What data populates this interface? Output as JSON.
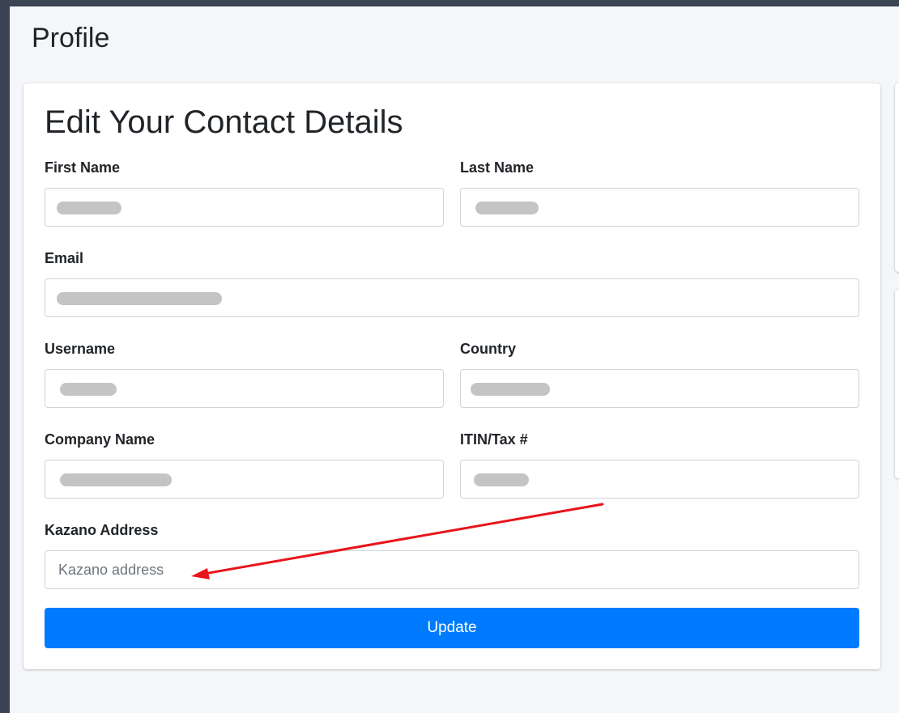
{
  "page": {
    "title": "Profile"
  },
  "form": {
    "heading": "Edit Your Contact Details",
    "fields": {
      "first_name": {
        "label": "First Name",
        "value": ""
      },
      "last_name": {
        "label": "Last Name",
        "value": ""
      },
      "email": {
        "label": "Email",
        "value": ""
      },
      "username": {
        "label": "Username",
        "value": ""
      },
      "country": {
        "label": "Country",
        "value": ""
      },
      "company_name": {
        "label": "Company Name",
        "value": ""
      },
      "tax": {
        "label": "ITIN/Tax #",
        "value": ""
      },
      "kazano_address": {
        "label": "Kazano Address",
        "value": "",
        "placeholder": "Kazano address"
      }
    },
    "submit_label": "Update"
  },
  "colors": {
    "primary": "#007bff",
    "annotation_arrow": "#e8141b",
    "frame": "#3b4452",
    "content_bg": "#f4f6f9"
  }
}
